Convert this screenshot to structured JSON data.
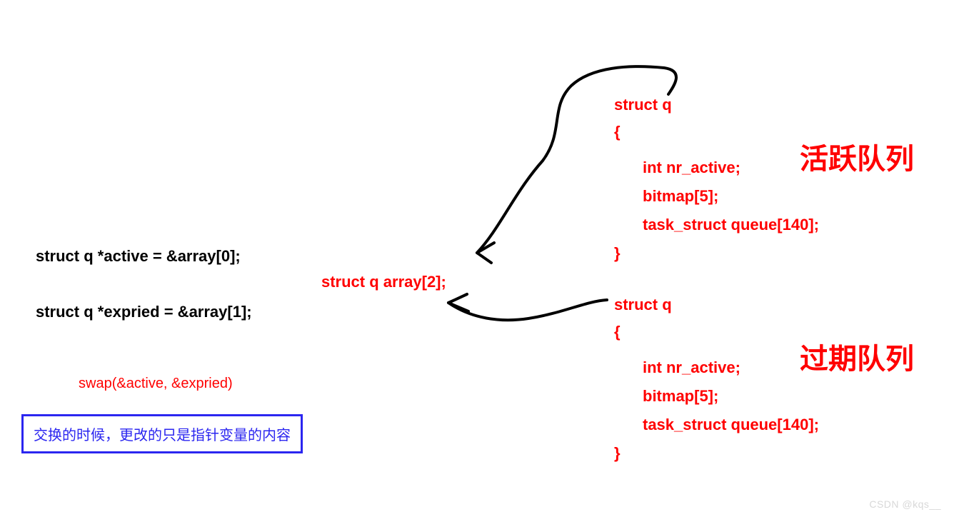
{
  "left": {
    "active_line": "struct q *active = &array[0];",
    "expired_line": "struct q *expried = &array[1];",
    "swap_line": "swap(&active, &expried)",
    "blue_box": "交换的时候，更改的只是指针变量的内容"
  },
  "center": {
    "array_decl": "struct q array[2];"
  },
  "struct_body": {
    "l1": "struct q",
    "l2": "{",
    "l3": "int nr_active;",
    "l4": "bitmap[5];",
    "l5": "task_struct queue[140];",
    "l6": "}"
  },
  "labels": {
    "active_queue": "活跃队列",
    "expired_queue": "过期队列"
  },
  "watermark": "CSDN @kqs__"
}
